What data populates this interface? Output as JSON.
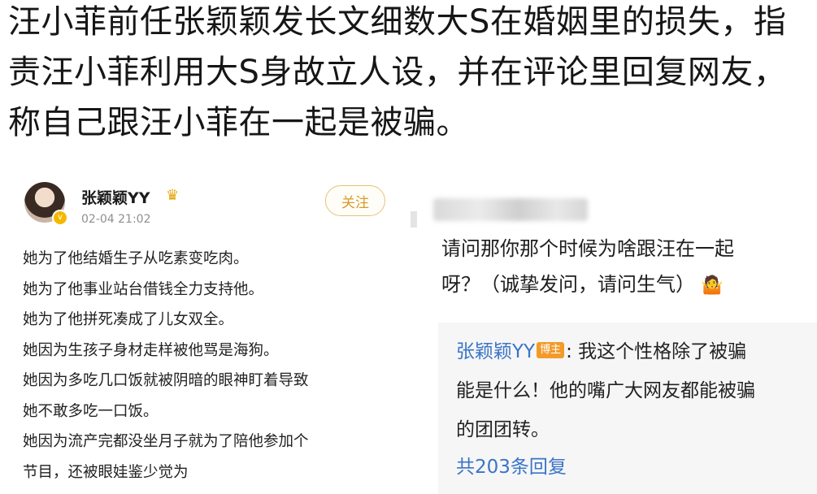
{
  "headline": "汪小菲前任张颖颖发长文细数大S在婚姻里的损失，指责汪小菲利用大S身故立人设，并在评论里回复网友，称自己跟汪小菲在一起是被骗。",
  "post": {
    "username": "张颖颖YY",
    "timestamp": "02-04 21:02",
    "follow_label": "关注",
    "lines": [
      "她为了他结婚生子从吃素变吃肉。",
      "她为了他事业站台借钱全力支持他。",
      "她为了他拼死凑成了儿女双全。",
      "她因为生孩子身材走样被他骂是海狗。",
      "她因为多吃几口饭就被阴暗的眼神盯着导致",
      "她不敢多吃一口饭。",
      "她因为流产完都没坐月子就为了陪他参加个",
      "节目，还被眼娃鉴少觉为"
    ]
  },
  "comment": {
    "line1": "请问那你那个时候为啥跟汪在一起",
    "line2": "呀？（诚挚发问，请问生气）",
    "emoji_icon": "confused-face-emoji"
  },
  "reply": {
    "author": "张颖颖YY",
    "badge": "博主",
    "line1": ": 我这个性格除了被骗",
    "line2": "能是什么！他的嘴广大网友都能被骗",
    "line3": "的团团转。",
    "count_label": "共203条回复"
  }
}
